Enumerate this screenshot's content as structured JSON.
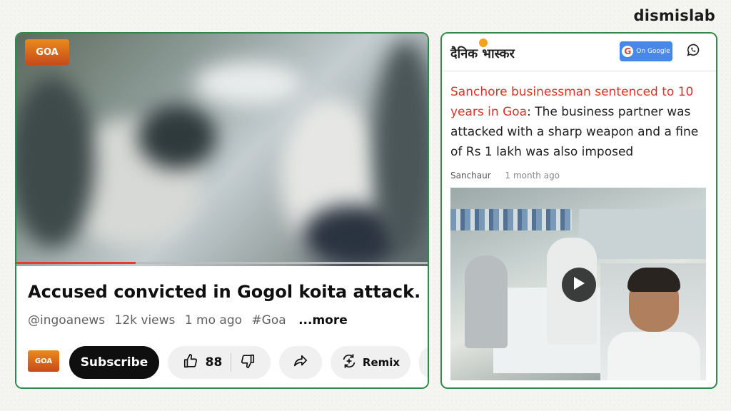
{
  "brand": "dismislab",
  "youtube": {
    "channel_logo_text": "GOA",
    "title": "Accused convicted in Gogol koita attack...",
    "channel": "@ingoanews",
    "views": "12k views",
    "age": "1 mo ago",
    "hashtag": "#Goa",
    "more": "...more",
    "subscribe_label": "Subscribe",
    "like_count": "88",
    "remix_label": "Remix",
    "progress_percent": 29
  },
  "article": {
    "publisher": "दैनिक भास्कर",
    "google_label": "On Google",
    "headline_red": "Sanchore businessman sentenced to 10 years in Goa",
    "headline_rest": ": The business partner was attacked with a sharp weapon and a fine of Rs 1 lakh was also imposed",
    "location": "Sanchaur",
    "time": "1 month ago"
  },
  "icons": [
    "thumbs-up-icon",
    "thumbs-down-icon",
    "share-icon",
    "remix-icon",
    "whatsapp-icon",
    "play-icon",
    "google-icon"
  ],
  "colors": {
    "frame_green": "#2e8b4a",
    "headline_red": "#d9342b",
    "progress_red": "#e53935"
  }
}
